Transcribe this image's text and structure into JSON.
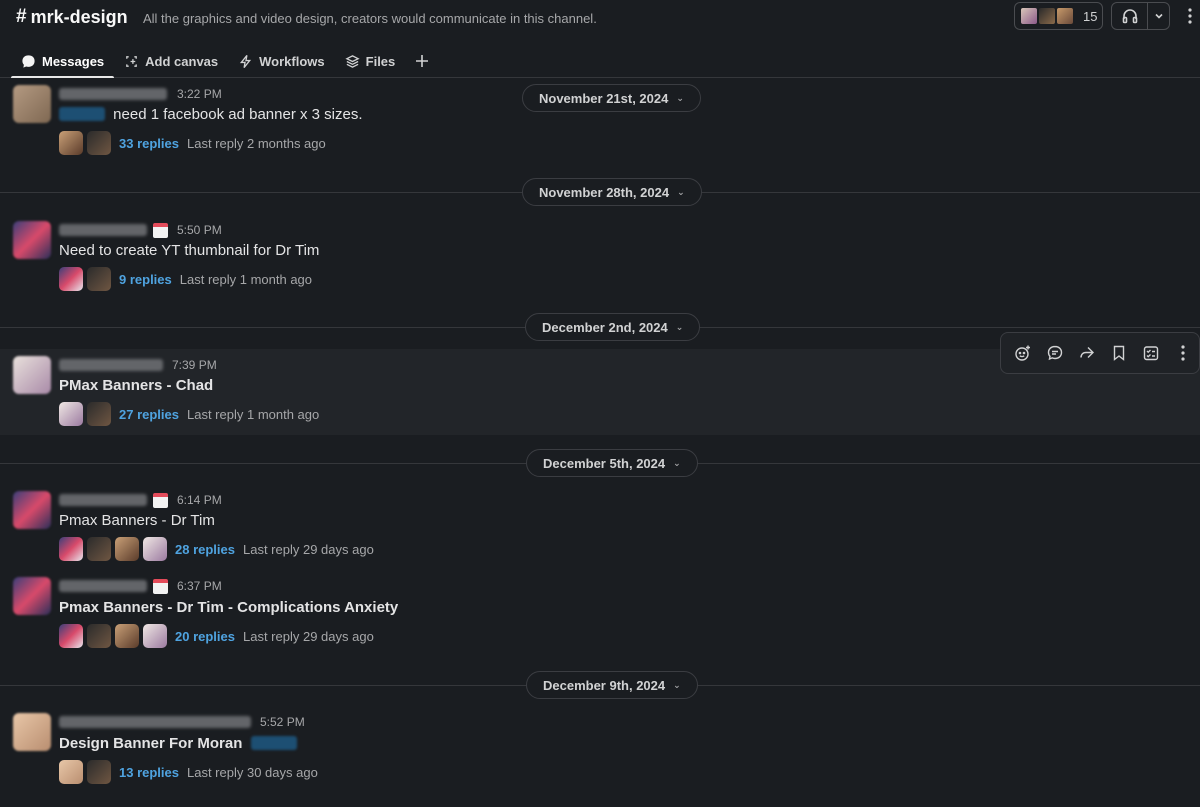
{
  "header": {
    "channel_name": "mrk-design",
    "hash": "#",
    "description": "All the graphics and video design, creators would communicate in this channel.",
    "member_count": "15"
  },
  "tabs": [
    {
      "label": "Messages",
      "icon": "chat-bubble-icon"
    },
    {
      "label": "Add canvas",
      "icon": "canvas-icon"
    },
    {
      "label": "Workflows",
      "icon": "lightning-icon"
    },
    {
      "label": "Files",
      "icon": "layers-icon"
    }
  ],
  "dates": [
    "November 21st, 2024",
    "November 28th, 2024",
    "December 2nd, 2024",
    "December 5th, 2024",
    "December 9th, 2024"
  ],
  "messages": [
    {
      "time": "3:22 PM",
      "text": "need 1 facebook ad banner x  3 sizes.",
      "replies": "33 replies",
      "last": "Last reply 2 months ago"
    },
    {
      "time": "5:50 PM",
      "text": "Need to create YT thumbnail for Dr Tim",
      "replies": "9 replies",
      "last": "Last reply 1 month ago"
    },
    {
      "time": "7:39 PM",
      "text": "PMax Banners - Chad",
      "replies": "27 replies",
      "last": "Last reply 1 month ago"
    },
    {
      "time": "6:14 PM",
      "text": "Pmax Banners - Dr Tim",
      "replies": "28 replies",
      "last": "Last reply 29 days ago"
    },
    {
      "time": "6:37 PM",
      "text": "Pmax Banners - Dr Tim - Complications Anxiety",
      "replies": "20 replies",
      "last": "Last reply 29 days ago"
    },
    {
      "time": "5:52 PM",
      "text": "Design Banner For Moran",
      "replies": "13 replies",
      "last": "Last reply 30 days ago"
    }
  ],
  "colors": {
    "background": "#1a1d21",
    "link": "#4fa3e0",
    "hover_row": "#222529"
  }
}
